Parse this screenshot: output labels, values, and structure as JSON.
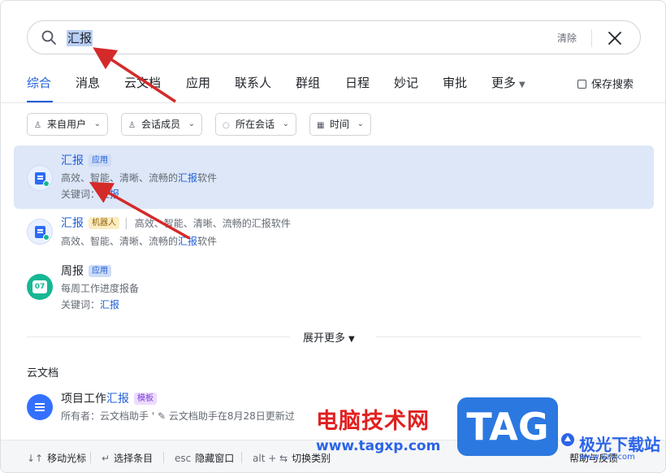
{
  "search": {
    "query": "汇报",
    "clear_label": "清除"
  },
  "tabs": [
    {
      "label": "综合",
      "active": true
    },
    {
      "label": "消息"
    },
    {
      "label": "云文档"
    },
    {
      "label": "应用"
    },
    {
      "label": "联系人"
    },
    {
      "label": "群组"
    },
    {
      "label": "日程"
    },
    {
      "label": "妙记"
    },
    {
      "label": "审批"
    },
    {
      "label": "更多"
    }
  ],
  "save_search_label": "保存搜索",
  "filters": [
    {
      "label": "来自用户",
      "icon": "user-icon"
    },
    {
      "label": "会话成员",
      "icon": "user-icon"
    },
    {
      "label": "所在会话",
      "icon": "chat-icon"
    },
    {
      "label": "时间",
      "icon": "calendar-icon"
    }
  ],
  "results": [
    {
      "title": "汇报",
      "tag": "应用",
      "desc_pre": "高效、智能、清晰、流畅的",
      "desc_hl": "汇报",
      "desc_post": "软件",
      "keyword_label": "关键词：",
      "keyword": "汇报"
    },
    {
      "title": "汇报",
      "tag": "机器人",
      "inline_desc": "高效、智能、清晰、流畅的汇报软件",
      "desc_pre": "高效、智能、清晰、流畅的",
      "desc_hl": "汇报",
      "desc_post": "软件"
    },
    {
      "title": "周报",
      "tag": "应用",
      "calendar_day": "07",
      "desc": "每周工作进度报备",
      "keyword_label": "关键词：",
      "keyword": "汇报"
    }
  ],
  "expand_label": "展开更多",
  "section_cloud_docs": "云文档",
  "doc_result": {
    "title_pre": "项目工作",
    "title_hl": "汇报",
    "tag": "模板",
    "owner": "所有者：云文档助手",
    "updated": "云文档助手在8月28日更新过"
  },
  "footer": {
    "move": {
      "key": "↓↑",
      "label": "移动光标"
    },
    "select": {
      "key": "↵",
      "label": "选择条目"
    },
    "hide": {
      "key": "esc",
      "label": "隐藏窗口"
    },
    "switch": {
      "key": "alt + ⇆",
      "label": "切换类别"
    },
    "help": "帮助与反馈"
  },
  "watermark": {
    "site_name": "电脑技术网",
    "site_url": "www.tagxp.com",
    "tag": "TAG",
    "jg_name": "极光下载站",
    "jg_url": "www.xz7.com"
  },
  "colors": {
    "accent": "#1f5fd6",
    "selected_bg": "#dde7f8",
    "arrow": "#d42a2a"
  }
}
